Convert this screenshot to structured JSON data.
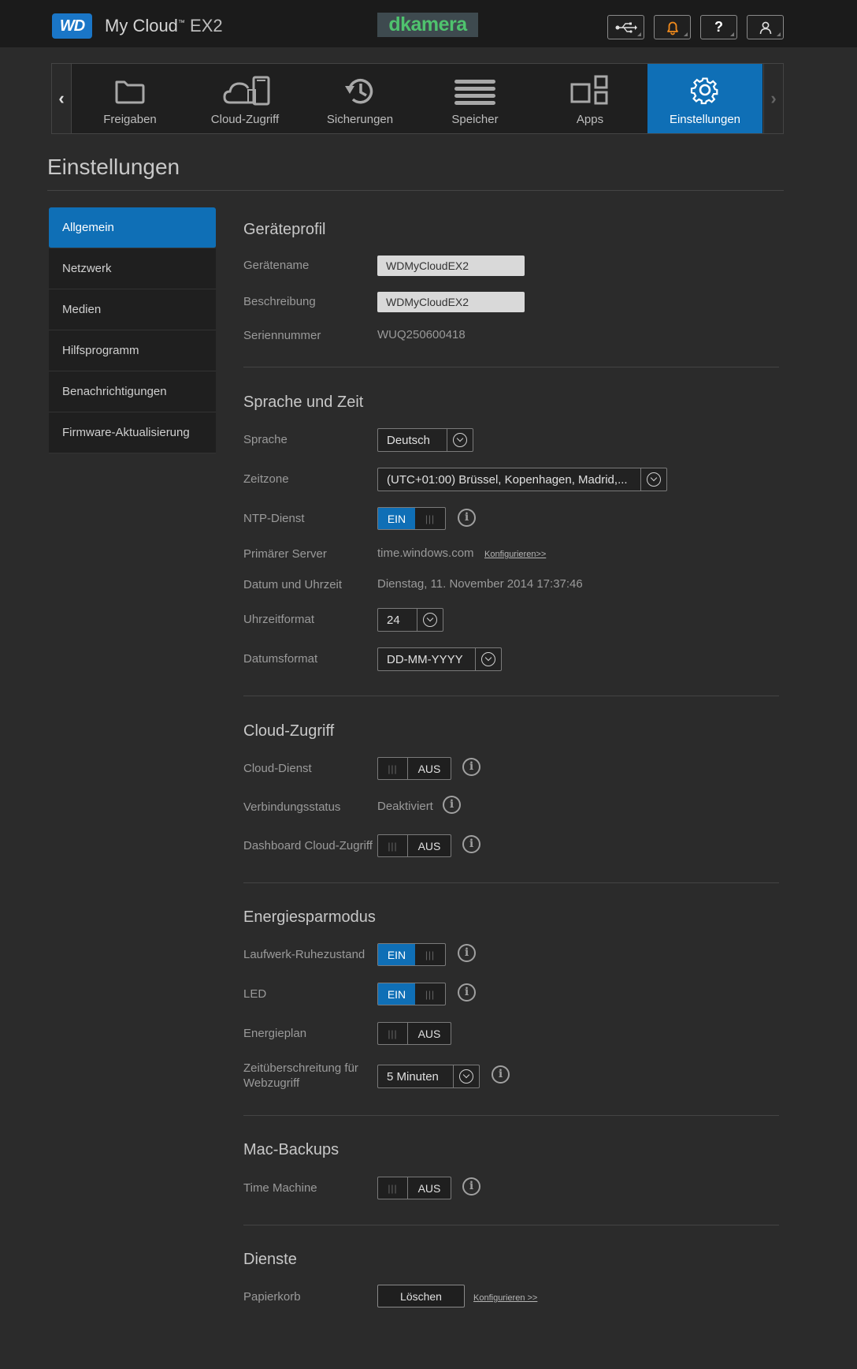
{
  "header": {
    "logo_text": "WD",
    "product_name": "My Cloud",
    "product_model": "EX2",
    "sponsor_text": "dkamera",
    "icons": [
      "usb-icon",
      "bell-icon",
      "help-icon",
      "user-icon"
    ],
    "help_glyph": "?"
  },
  "nav": {
    "items": [
      {
        "label": "Freigaben",
        "icon": "folder-icon"
      },
      {
        "label": "Cloud-Zugriff",
        "icon": "cloud-devices-icon"
      },
      {
        "label": "Sicherungen",
        "icon": "history-icon"
      },
      {
        "label": "Speicher",
        "icon": "storage-icon"
      },
      {
        "label": "Apps",
        "icon": "apps-icon"
      },
      {
        "label": "Einstellungen",
        "icon": "gear-icon"
      }
    ],
    "active_index": 5,
    "active_color": "#0f6fb6"
  },
  "page_title": "Einstellungen",
  "sidebar": {
    "items": [
      {
        "label": "Allgemein"
      },
      {
        "label": "Netzwerk"
      },
      {
        "label": "Medien"
      },
      {
        "label": "Hilfsprogramm"
      },
      {
        "label": "Benachrichtigungen"
      },
      {
        "label": "Firmware-Aktualisierung"
      }
    ]
  },
  "sections": {
    "profile": {
      "title": "Geräteprofil",
      "device_name_label": "Gerätename",
      "device_name_value": "WDMyCloudEX2",
      "description_label": "Beschreibung",
      "description_value": "WDMyCloudEX2",
      "serial_label": "Seriennummer",
      "serial_value": "WUQ250600418"
    },
    "lang_time": {
      "title": "Sprache und Zeit",
      "language_label": "Sprache",
      "language_value": "Deutsch",
      "timezone_label": "Zeitzone",
      "timezone_value": "(UTC+01:00) Brüssel, Kopenhagen, Madrid,...",
      "ntp_label": "NTP-Dienst",
      "ntp_state": "EIN",
      "primary_server_label": "Primärer Server",
      "primary_server_value": "time.windows.com",
      "configure_link": "Konfigurieren>>",
      "datetime_label": "Datum und Uhrzeit",
      "datetime_value": "Dienstag, 11. November 2014 17:37:46",
      "timeformat_label": "Uhrzeitformat",
      "timeformat_value": "24",
      "dateformat_label": "Datumsformat",
      "dateformat_value": "DD-MM-YYYY"
    },
    "cloud": {
      "title": "Cloud-Zugriff",
      "cloud_service_label": "Cloud-Dienst",
      "cloud_service_state": "AUS",
      "conn_status_label": "Verbindungsstatus",
      "conn_status_value": "Deaktiviert",
      "dashboard_label": "Dashboard Cloud-Zugriff",
      "dashboard_state": "AUS"
    },
    "energy": {
      "title": "Energiesparmodus",
      "drive_sleep_label": "Laufwerk-Ruhezustand",
      "drive_sleep_state": "EIN",
      "led_label": "LED",
      "led_state": "EIN",
      "plan_label": "Energieplan",
      "plan_state": "AUS",
      "timeout_label": "Zeitüberschreitung für Webzugriff",
      "timeout_value": "5 Minuten"
    },
    "mac": {
      "title": "Mac-Backups",
      "tm_label": "Time Machine",
      "tm_state": "AUS"
    },
    "services": {
      "title": "Dienste",
      "trash_label": "Papierkorb",
      "trash_button": "Löschen",
      "configure_link": "Konfigurieren >>"
    }
  },
  "toggle_grip": "|||",
  "info_glyph": "i"
}
